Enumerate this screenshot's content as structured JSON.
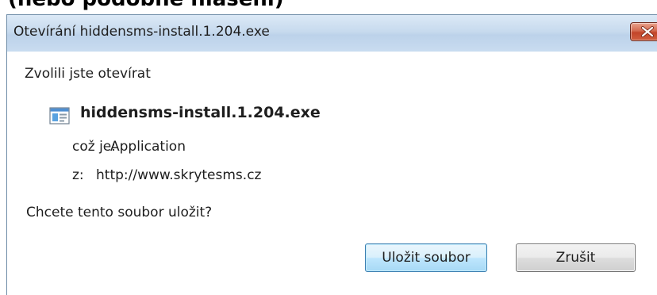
{
  "page": {
    "top_caption": "(nebo podobné hlášení)"
  },
  "window": {
    "title": "Otevírání hiddensms-install.1.204.exe",
    "close_icon": "close-icon"
  },
  "dialog": {
    "prompt": "Zvolili jste otevírat",
    "file_icon": "application-file-icon",
    "file_name": "hiddensms-install.1.204.exe",
    "type_label": "což je:",
    "type_value": "Application",
    "from_label": "z:",
    "from_value": "http://www.skrytesms.cz",
    "question": "Chcete tento soubor uložit?"
  },
  "buttons": {
    "save_label": "Uložit soubor",
    "cancel_label": "Zrušit"
  },
  "colors": {
    "titlebar": "#c7daee",
    "close_button": "#c2452a",
    "default_button_border": "#3c7fb1"
  }
}
